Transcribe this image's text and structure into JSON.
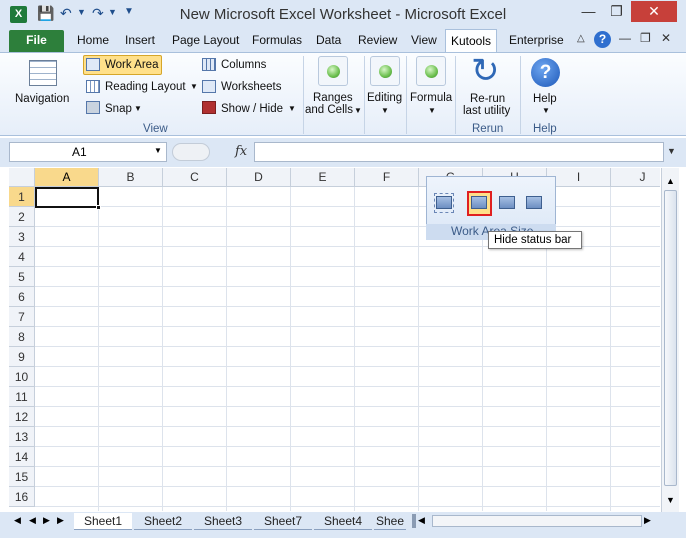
{
  "window": {
    "title": "New Microsoft Excel Worksheet - Microsoft Excel"
  },
  "tabs": [
    "File",
    "Home",
    "Insert",
    "Page Layout",
    "Formulas",
    "Data",
    "Review",
    "View",
    "Kutools",
    "Enterprise"
  ],
  "ribbon": {
    "navigation": "Navigation",
    "work_area": "Work Area",
    "reading_layout": "Reading Layout",
    "snap": "Snap",
    "columns": "Columns",
    "worksheets": "Worksheets",
    "show_hide": "Show / Hide",
    "view_group": "View",
    "ranges_cells_1": "Ranges",
    "ranges_cells_2": "and Cells",
    "editing": "Editing",
    "formula": "Formula",
    "rerun_1": "Re-run",
    "rerun_2": "last utility",
    "rerun_group": "Rerun",
    "help": "Help",
    "help_group": "Help"
  },
  "formula_bar": {
    "name_box": "A1",
    "fx": "fx",
    "content": ""
  },
  "grid": {
    "columns": [
      "A",
      "B",
      "C",
      "D",
      "E",
      "F",
      "G",
      "H",
      "I",
      "J"
    ],
    "rows": [
      "1",
      "2",
      "3",
      "4",
      "5",
      "6",
      "7",
      "8",
      "9",
      "10",
      "11",
      "12",
      "13",
      "14",
      "15",
      "16"
    ],
    "selected": "A1"
  },
  "popup": {
    "label": "Work Area Size",
    "tooltip": "Hide status bar"
  },
  "sheets": [
    "Sheet1",
    "Sheet2",
    "Sheet3",
    "Sheet7",
    "Sheet4",
    "Shee"
  ],
  "colors": {
    "file_tab": "#2d7f3b",
    "ribbon_bg": "#dce7f5",
    "highlight": "#ffe08a",
    "red_outline": "#e02020"
  }
}
